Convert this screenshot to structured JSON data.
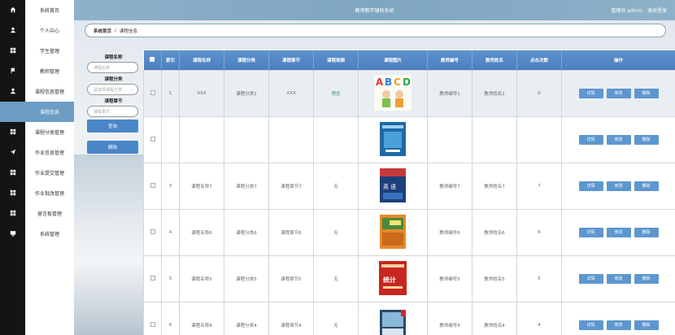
{
  "app": {
    "title": "教师教学辅助系统",
    "user_label": "管理员 admin",
    "logout_label": "退出登录"
  },
  "sidebar": {
    "items": [
      {
        "label": "系统首页",
        "icon": "home-icon"
      },
      {
        "label": "个人中心",
        "icon": "person-icon"
      },
      {
        "label": "学生管理",
        "icon": "grid-icon"
      },
      {
        "label": "教师管理",
        "icon": "flag-icon"
      },
      {
        "label": "课程信息管理",
        "icon": "person-icon"
      },
      {
        "label": "课程信息",
        "icon": "",
        "active": true
      },
      {
        "label": "课程分类管理",
        "icon": "grid-icon"
      },
      {
        "label": "作业信息管理",
        "icon": "send-icon"
      },
      {
        "label": "作业提交管理",
        "icon": "grid-icon"
      },
      {
        "label": "作业批改管理",
        "icon": "grid-icon"
      },
      {
        "label": "留言板管理",
        "icon": "grid-icon"
      },
      {
        "label": "系统管理",
        "icon": "monitor-icon"
      }
    ]
  },
  "breadcrumb": {
    "home": "系统首页",
    "separator": "/",
    "current": "课程信息"
  },
  "search": {
    "name_label": "课程名称",
    "name_placeholder": "课程名称",
    "category_label": "课程分类",
    "category_placeholder": "请选择课程分类",
    "chapter_label": "课程章节",
    "chapter_placeholder": "课程章节",
    "search_button": "查询",
    "delete_button": "删除"
  },
  "table": {
    "columns": [
      "索引",
      "课程名称",
      "课程分类",
      "课程章节",
      "课程视频",
      "课程图片",
      "教师编号",
      "教师姓名",
      "点击次数",
      "操作"
    ],
    "actions": {
      "detail": "详情",
      "edit": "修改",
      "delete": "删除"
    },
    "rows": [
      {
        "index": "1",
        "name": "XXX",
        "category": "课程分类1",
        "chapter": "XXX",
        "video": "预览",
        "image": "abcd-book",
        "teacher_no": "教师编号1",
        "teacher_name": "教师姓名1",
        "clicks": "0",
        "highlight": true
      },
      {
        "index": "",
        "name": "",
        "category": "",
        "chapter": "",
        "video": "",
        "image": "blue-book",
        "teacher_no": "",
        "teacher_name": "",
        "clicks": ""
      },
      {
        "index": "3",
        "name": "课程名称7",
        "category": "课程分类7",
        "chapter": "课程章节7",
        "video": "无",
        "image": "english-book",
        "teacher_no": "教师编号7",
        "teacher_name": "教师姓名7",
        "clicks": "7"
      },
      {
        "index": "4",
        "name": "课程名称6",
        "category": "课程分类6",
        "chapter": "课程章节6",
        "video": "无",
        "image": "orange-book",
        "teacher_no": "教师编号6",
        "teacher_name": "教师姓名6",
        "clicks": "6"
      },
      {
        "index": "5",
        "name": "课程名称5",
        "category": "课程分类5",
        "chapter": "课程章节5",
        "video": "无",
        "image": "stats-book",
        "teacher_no": "教师编号5",
        "teacher_name": "教师姓名5",
        "clicks": "5"
      },
      {
        "index": "6",
        "name": "课程名称4",
        "category": "课程分类4",
        "chapter": "课程章节4",
        "video": "无",
        "image": "photo-book",
        "teacher_no": "教师编号4",
        "teacher_name": "教师姓名4",
        "clicks": "4"
      }
    ]
  },
  "colors": {
    "accent": "#4a86c8",
    "header": "#7ea5c2",
    "sidebar_active": "#6b9dc5"
  }
}
